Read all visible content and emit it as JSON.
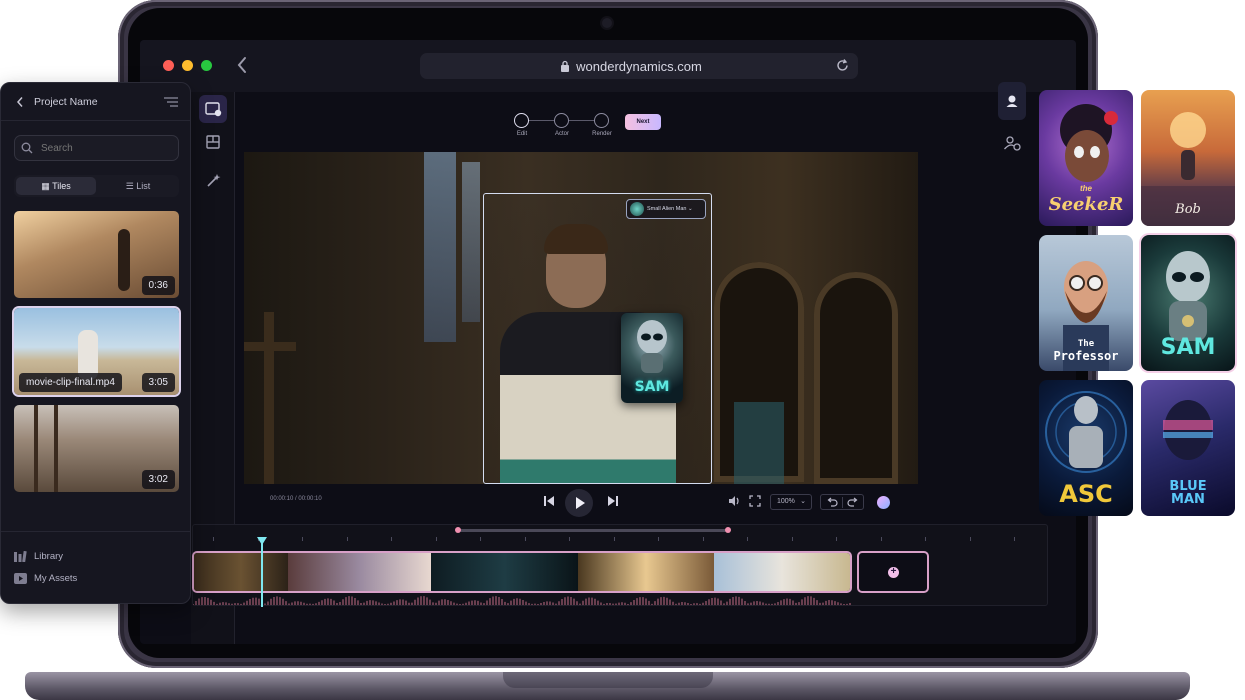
{
  "browser": {
    "url": "wonderdynamics.com"
  },
  "stepper": {
    "steps": [
      {
        "label": "Edit"
      },
      {
        "label": "Actor"
      },
      {
        "label": "Render"
      }
    ],
    "next_label": "Next"
  },
  "video": {
    "actor_chip_label": "Small Alien Man",
    "sam_label": "SAM"
  },
  "player": {
    "timecode": "00:00:10 / 00:00:10",
    "zoom": "100%"
  },
  "left_panel": {
    "title": "Project Name",
    "search_placeholder": "Search",
    "view_tiles": "Tiles",
    "view_list": "List",
    "clips": [
      {
        "duration": "0:36"
      },
      {
        "name": "movie-clip-final.mp4",
        "duration": "3:05"
      },
      {
        "duration": "3:02"
      }
    ],
    "nav": [
      {
        "label": "Library"
      },
      {
        "label": "My Assets"
      }
    ]
  },
  "characters": [
    {
      "label_top": "the",
      "label_main": "SeekeR"
    },
    {
      "label_main": "Bob"
    },
    {
      "label_top": "The",
      "label_main": "Professor"
    },
    {
      "label_main": "SAM"
    },
    {
      "label_main": "ASC"
    },
    {
      "label_main": "BLUE MAN"
    }
  ],
  "colors": {
    "accent": "#d8a0c8",
    "playhead": "#7fe8f0",
    "panel_bg": "#161620"
  }
}
